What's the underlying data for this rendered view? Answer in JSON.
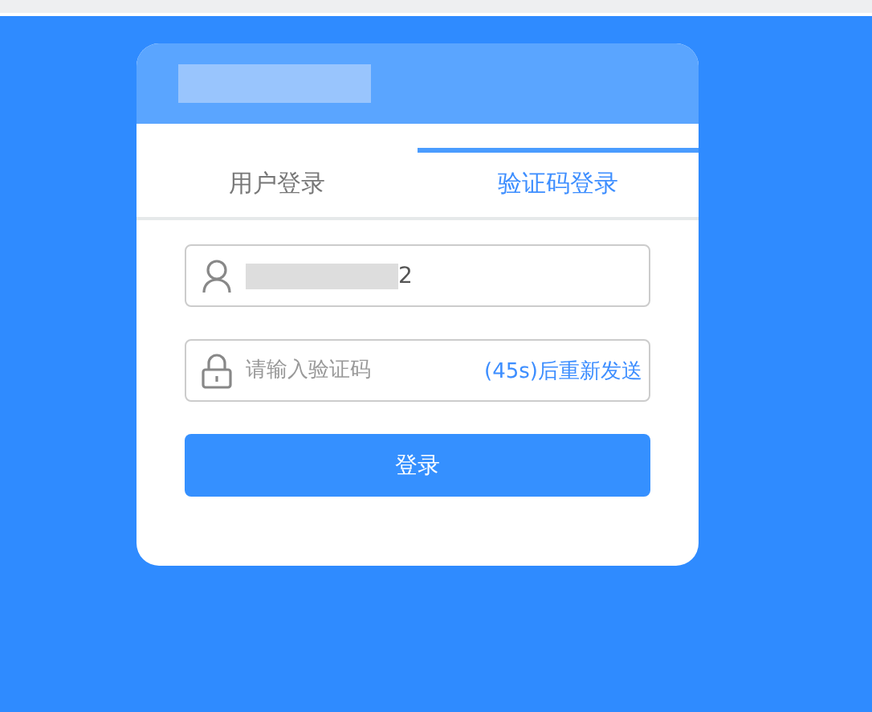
{
  "tabs": [
    {
      "label": "用户登录",
      "selected": false
    },
    {
      "label": "验证码登录",
      "selected": true
    }
  ],
  "username": {
    "value": "2"
  },
  "code": {
    "placeholder": "请输入验证码",
    "resend": "(45s)后重新发送"
  },
  "buttons": [
    "登录"
  ]
}
